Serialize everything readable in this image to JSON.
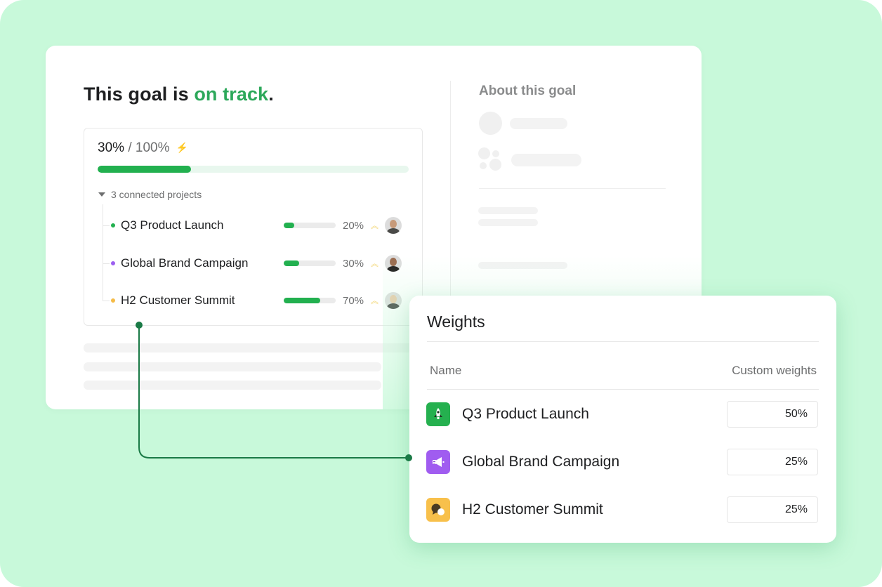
{
  "colors": {
    "background": "#c8f9da",
    "accent_green": "#22b04f",
    "status_text": "#2ca85a",
    "connector": "#1a7a46"
  },
  "goal": {
    "title_prefix": "This goal is",
    "status": "on track",
    "title_suffix": ".",
    "progress": {
      "current": "30%",
      "separator": "/",
      "target": "100%",
      "fraction": 0.3,
      "icon": "bolt-icon"
    },
    "connected_label": "3 connected projects",
    "projects": [
      {
        "name": "Q3 Product Launch",
        "dot_color": "#22b04f",
        "progress": 0.2,
        "percent": "20%",
        "trend_icon": "double-chevron-up-icon",
        "owner": "man-with-beard"
      },
      {
        "name": "Global Brand Campaign",
        "dot_color": "#9c5ff0",
        "progress": 0.3,
        "percent": "30%",
        "trend_icon": "double-chevron-up-icon",
        "owner": "woman-dark-hair"
      },
      {
        "name": "H2 Customer Summit",
        "dot_color": "#f5bb47",
        "progress": 0.7,
        "percent": "70%",
        "trend_icon": "double-chevron-up-icon",
        "owner": "woman-blonde-hair"
      }
    ]
  },
  "about": {
    "title": "About this goal"
  },
  "weights": {
    "title": "Weights",
    "columns": {
      "name": "Name",
      "weight": "Custom weights"
    },
    "rows": [
      {
        "name": "Q3 Product Launch",
        "icon": "rocket-icon",
        "icon_bg": "#25b04f",
        "weight": "50%"
      },
      {
        "name": "Global Brand Campaign",
        "icon": "megaphone-icon",
        "icon_bg": "#a05cf0",
        "weight": "25%"
      },
      {
        "name": "H2 Customer Summit",
        "icon": "chat-bubbles-icon",
        "icon_bg": "#f8c04b",
        "weight": "25%"
      }
    ]
  }
}
